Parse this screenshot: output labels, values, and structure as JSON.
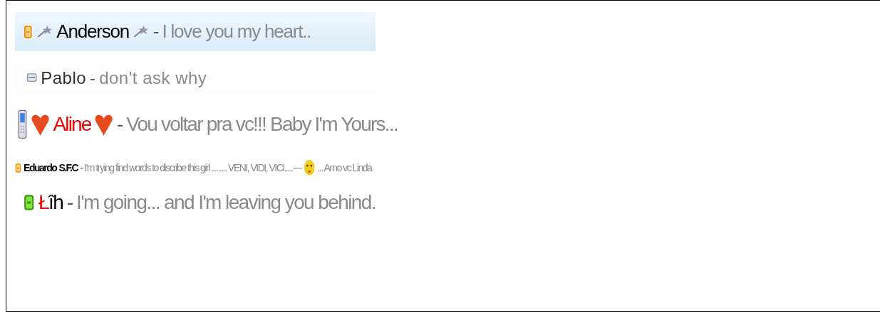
{
  "contacts": [
    {
      "kind": "away",
      "selected": true,
      "name": [
        {
          "kind": "wand"
        },
        {
          "kind": "text",
          "text": "Anderson",
          "color": "#000000"
        },
        {
          "kind": "wand"
        }
      ],
      "separator": "-",
      "message": [
        {
          "kind": "text",
          "text": "I love you my heart.."
        }
      ]
    },
    {
      "kind": "offline",
      "selected": false,
      "name": [
        {
          "kind": "text",
          "text": "Pablo",
          "color": "#333333"
        }
      ],
      "separator": "-",
      "message": [
        {
          "kind": "text",
          "text": "don't ask why"
        }
      ]
    },
    {
      "kind": "mobile",
      "selected": false,
      "name": [
        {
          "kind": "heart"
        },
        {
          "kind": "text",
          "text": "Aline",
          "color": "#ee0000"
        },
        {
          "kind": "heart"
        }
      ],
      "separator": "-",
      "message": [
        {
          "kind": "text",
          "text": "Vou voltar pra vc!!! Baby I'm Yours..."
        }
      ]
    },
    {
      "kind": "away",
      "selected": false,
      "name": [
        {
          "kind": "text",
          "text": "Eduardo",
          "color": "#000000"
        },
        {
          "kind": "text",
          "text": "S.F.C",
          "color": "#000000"
        }
      ],
      "separator": "-",
      "message": [
        {
          "kind": "text",
          "text": "I'm trying find words to discribe this girl ......... VENI, VIDI, VICI.....----"
        },
        {
          "kind": "emoticon"
        },
        {
          "kind": "text",
          "text": "... Amo vc Linda"
        }
      ]
    },
    {
      "kind": "online",
      "selected": false,
      "name": [
        {
          "kind": "text",
          "text": "Ł",
          "color": "#ee0000"
        },
        {
          "kind": "text",
          "text": "îh",
          "color": "#000000"
        }
      ],
      "separator": "-",
      "message": [
        {
          "kind": "text",
          "text": "I'm going... and I'm leaving you behind."
        }
      ]
    }
  ]
}
